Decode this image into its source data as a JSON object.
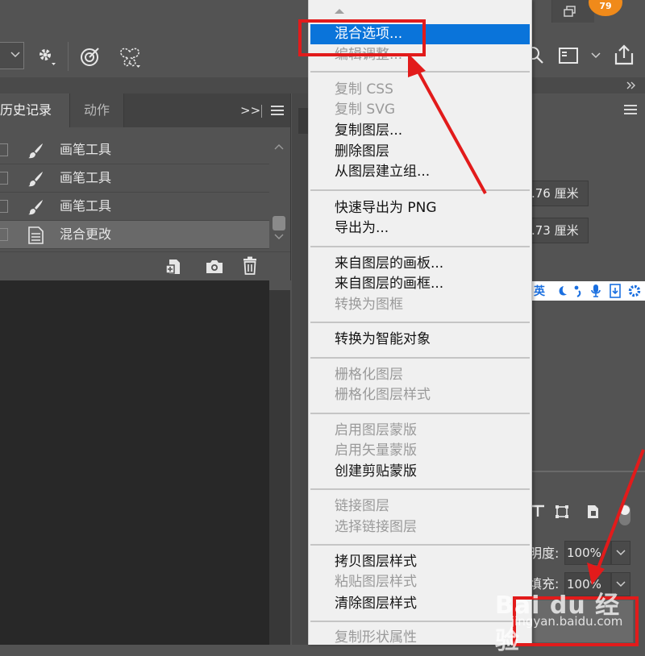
{
  "notification_badge": "79",
  "history_panel": {
    "tabs": [
      {
        "label": "历史记录",
        "active": true
      },
      {
        "label": "动作",
        "active": false
      }
    ],
    "overflow_symbol": ">>",
    "rows": [
      {
        "label": "画笔工具",
        "icon": "brush-icon",
        "selected": false
      },
      {
        "label": "画笔工具",
        "icon": "brush-icon",
        "selected": false
      },
      {
        "label": "画笔工具",
        "icon": "brush-icon",
        "selected": false
      },
      {
        "label": "混合更改",
        "icon": "document-icon",
        "selected": true
      }
    ],
    "footer_icons": [
      "new-document-from-state-icon",
      "camera-icon",
      "trash-icon"
    ]
  },
  "right_panel": {
    "width_value": ".76 厘米",
    "height_value": ".73 厘米",
    "opacity_label": "明度:",
    "opacity_value": "100%",
    "fill_label": "填充:",
    "fill_value": "100%"
  },
  "ime_toolbar": {
    "language": "英",
    "icons": [
      "moon-icon",
      "punctuation-icon",
      "microphone-icon",
      "keyboard-icon",
      "settings-icon"
    ]
  },
  "context_menu": {
    "highlight_color": "#0a74da",
    "groups": [
      [
        {
          "label": "混合选项...",
          "state": "highlighted"
        },
        {
          "label": "编辑调整...",
          "state": "disabled"
        }
      ],
      [
        {
          "label": "复制 CSS",
          "state": "disabled"
        },
        {
          "label": "复制 SVG",
          "state": "disabled"
        },
        {
          "label": "复制图层...",
          "state": "enabled"
        },
        {
          "label": "删除图层",
          "state": "enabled"
        },
        {
          "label": "从图层建立组...",
          "state": "enabled"
        }
      ],
      [
        {
          "label": "快速导出为 PNG",
          "state": "enabled"
        },
        {
          "label": "导出为...",
          "state": "enabled"
        }
      ],
      [
        {
          "label": "来自图层的画板...",
          "state": "enabled"
        },
        {
          "label": "来自图层的画框...",
          "state": "enabled"
        },
        {
          "label": "转换为图框",
          "state": "disabled"
        }
      ],
      [
        {
          "label": "转换为智能对象",
          "state": "enabled"
        }
      ],
      [
        {
          "label": "栅格化图层",
          "state": "disabled"
        },
        {
          "label": "栅格化图层样式",
          "state": "disabled"
        }
      ],
      [
        {
          "label": "启用图层蒙版",
          "state": "disabled"
        },
        {
          "label": "启用矢量蒙版",
          "state": "disabled"
        },
        {
          "label": "创建剪贴蒙版",
          "state": "enabled"
        }
      ],
      [
        {
          "label": "链接图层",
          "state": "disabled"
        },
        {
          "label": "选择链接图层",
          "state": "disabled"
        }
      ],
      [
        {
          "label": "拷贝图层样式",
          "state": "enabled"
        },
        {
          "label": "粘贴图层样式",
          "state": "disabled"
        },
        {
          "label": "清除图层样式",
          "state": "enabled"
        }
      ],
      [
        {
          "label": "复制形状属性",
          "state": "disabled"
        }
      ]
    ]
  },
  "annotation_color": "#e21b1b",
  "watermark": {
    "logo": "Bai du 经验",
    "url": "jingyan.baidu.com"
  }
}
